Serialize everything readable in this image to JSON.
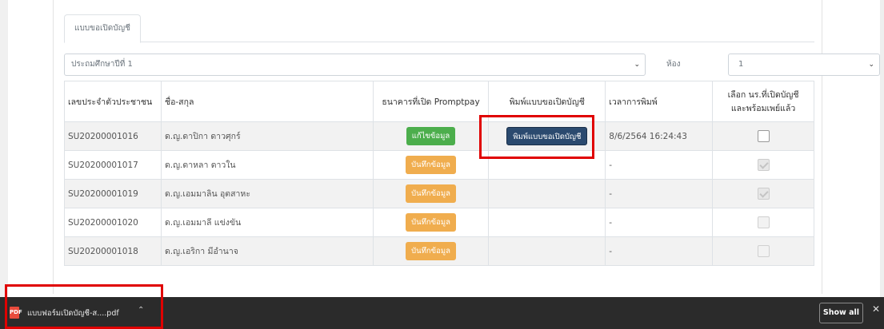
{
  "tab": {
    "label": "แบบขอเปิดบัญชี"
  },
  "filters": {
    "grade_value": "ประถมศึกษาปีที่ 1",
    "room_label": "ห้อง",
    "room_value": "1"
  },
  "table": {
    "headers": {
      "id": "เลขประจำตัวประชาชน",
      "name": "ชื่อ-สกุล",
      "bank": "ธนาคารที่เปิด Promptpay",
      "print": "พิมพ์แบบขอเปิดบัญชี",
      "time": "เวลาการพิมพ์",
      "select_line1": "เลือก นร.ที่เปิดบัญชี",
      "select_line2": "และพร้อมเพย์แล้ว"
    },
    "rows": [
      {
        "id": "SU20200001016",
        "name": "ด.ญ.ดาปิกา ดาวศุกร์",
        "bank_button": "แก้ไขข้อมูล",
        "print_button": "พิมพ์แบบขอเปิดบัญชี",
        "time": "8/6/2564 16:24:43"
      },
      {
        "id": "SU20200001017",
        "name": "ด.ญ.ดาหลา ดาวใน",
        "bank_button": "บันทึกข้อมูล",
        "time": "-"
      },
      {
        "id": "SU20200001019",
        "name": "ด.ญ.เอมมาลิน อุตสาหะ",
        "bank_button": "บันทึกข้อมูล",
        "time": "-"
      },
      {
        "id": "SU20200001020",
        "name": "ด.ญ.เอมมาลี แข่งขัน",
        "bank_button": "บันทึกข้อมูล",
        "time": "-"
      },
      {
        "id": "SU20200001018",
        "name": "ด.ญ.เอริกา มีอำนาจ",
        "bank_button": "บันทึกข้อมูล",
        "time": "-"
      }
    ]
  },
  "download_bar": {
    "filename": "แบบฟอร์มเปิดบัญชี-ส....pdf",
    "file_icon_text": "PDF",
    "show_all_label": "Show all",
    "close_label": "✕"
  },
  "colors": {
    "button_green": "#4cae4c",
    "button_orange": "#f0ad4e",
    "button_navy": "#2b4a6f",
    "highlight_red": "#e00000"
  }
}
